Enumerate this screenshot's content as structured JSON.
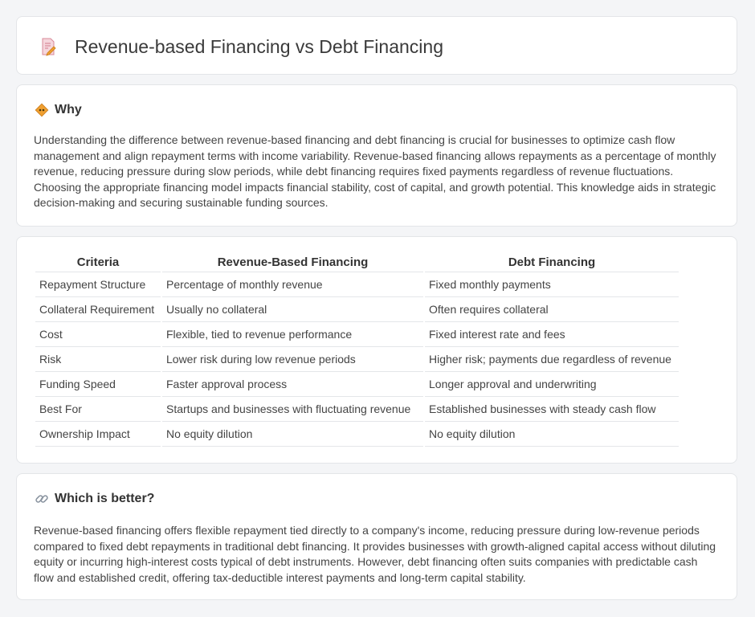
{
  "header": {
    "title": "Revenue-based Financing vs Debt Financing",
    "icon": "document-pencil-icon"
  },
  "why": {
    "icon": "diamond-sign-icon",
    "title": "Why",
    "text": "Understanding the difference between revenue-based financing and debt financing is crucial for businesses to optimize cash flow management and align repayment terms with income variability. Revenue-based financing allows repayments as a percentage of monthly revenue, reducing pressure during slow periods, while debt financing requires fixed payments regardless of revenue fluctuations. Choosing the appropriate financing model impacts financial stability, cost of capital, and growth potential. This knowledge aids in strategic decision-making and securing sustainable funding sources."
  },
  "table": {
    "headers": [
      "Criteria",
      "Revenue-Based Financing",
      "Debt Financing"
    ],
    "rows": [
      [
        "Repayment Structure",
        "Percentage of monthly revenue",
        "Fixed monthly payments"
      ],
      [
        "Collateral Requirement",
        "Usually no collateral",
        "Often requires collateral"
      ],
      [
        "Cost",
        "Flexible, tied to revenue performance",
        "Fixed interest rate and fees"
      ],
      [
        "Risk",
        "Lower risk during low revenue periods",
        "Higher risk; payments due regardless of revenue"
      ],
      [
        "Funding Speed",
        "Faster approval process",
        "Longer approval and underwriting"
      ],
      [
        "Best For",
        "Startups and businesses with fluctuating revenue",
        "Established businesses with steady cash flow"
      ],
      [
        "Ownership Impact",
        "No equity dilution",
        "No equity dilution"
      ]
    ]
  },
  "better": {
    "icon": "link-icon",
    "title": "Which is better?",
    "text": "Revenue-based financing offers flexible repayment tied directly to a company's income, reducing pressure during low-revenue periods compared to fixed debt repayments in traditional debt financing. It provides businesses with growth-aligned capital access without diluting equity or incurring high-interest costs typical of debt instruments. However, debt financing often suits companies with predictable cash flow and established credit, offering tax-deductible interest payments and long-term capital stability."
  },
  "colors": {
    "background": "#f4f5f7",
    "card": "#ffffff",
    "border": "#e3e5e8",
    "icon_accent": "#f0a030",
    "icon_pink": "#e57a8a"
  }
}
